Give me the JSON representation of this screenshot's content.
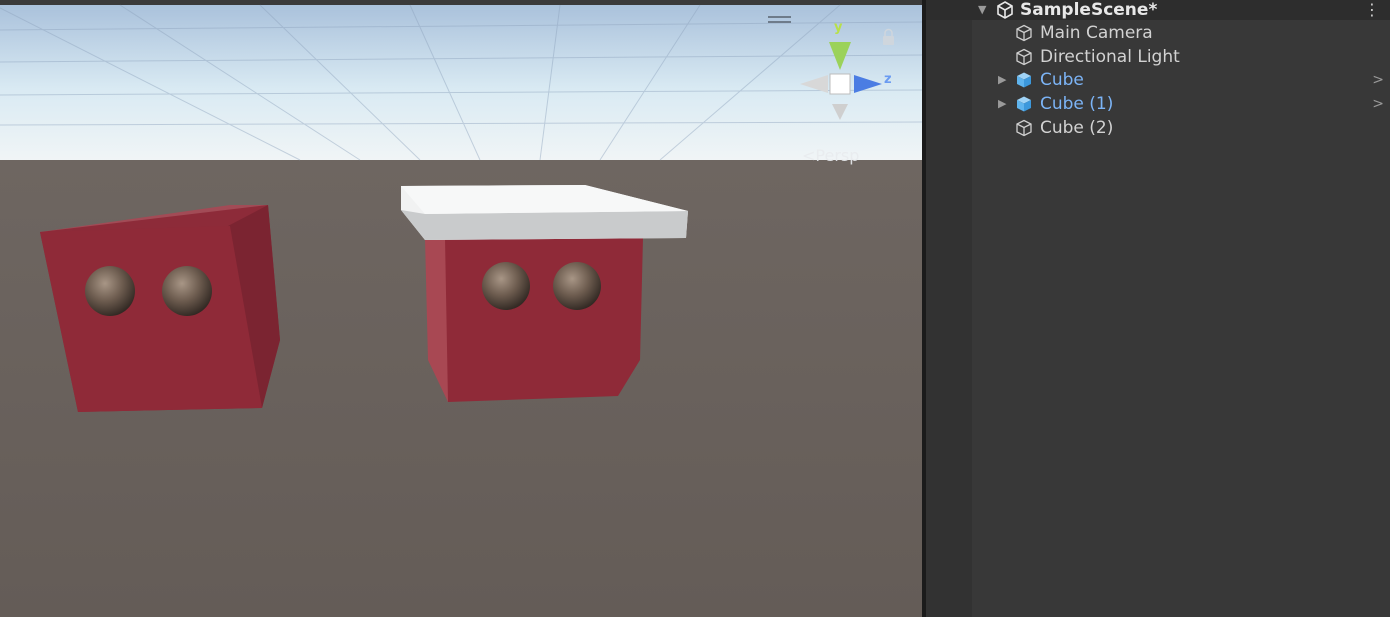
{
  "scene_view": {
    "projection_label": "<Persp",
    "gizmo": {
      "y_label": "y",
      "z_label": "z"
    },
    "colors": {
      "sky_top": "#9fb8d6",
      "sky_horizon": "#eef6fb",
      "ground": "#6a615c",
      "cube_red": "#8d2b39",
      "platform": "#f1f2f2"
    }
  },
  "hierarchy": {
    "scene": {
      "name": "SampleScene*",
      "menu_icon": "kebab-menu-icon"
    },
    "items": [
      {
        "label": "Main Camera",
        "icon": "gameobject-icon",
        "prefab": false,
        "expandable": false
      },
      {
        "label": "Directional Light",
        "icon": "gameobject-icon",
        "prefab": false,
        "expandable": false
      },
      {
        "label": "Cube",
        "icon": "prefab-icon",
        "prefab": true,
        "expandable": true
      },
      {
        "label": "Cube (1)",
        "icon": "prefab-icon",
        "prefab": true,
        "expandable": true
      },
      {
        "label": "Cube (2)",
        "icon": "gameobject-icon",
        "prefab": false,
        "expandable": false
      }
    ]
  }
}
